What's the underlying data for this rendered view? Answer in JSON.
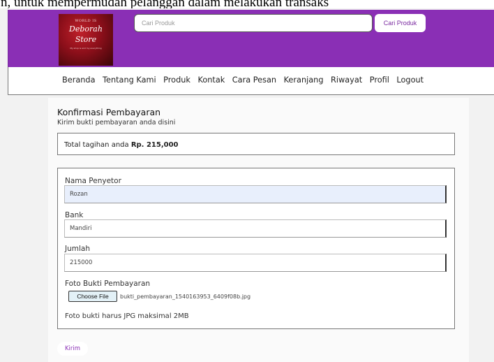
{
  "marquee": {
    "text": "n, untuk mempermudah pelanggan dalam melakukan transaks"
  },
  "logo": {
    "small": "WORLD IS",
    "script_line1": "Deborah",
    "script_line2": "Store",
    "tagline": "My shop is and my everything"
  },
  "search": {
    "placeholder": "Cari Produk",
    "button_label": "Cari Produk"
  },
  "nav": {
    "items": [
      "Beranda",
      "Tentang Kami",
      "Produk",
      "Kontak",
      "Cara Pesan",
      "Keranjang",
      "Riwayat",
      "Profil",
      "Logout"
    ]
  },
  "page": {
    "title": "Konfirmasi Pembayaran",
    "subtitle": "Kirim bukti pembayaran anda disini",
    "total_prefix": "Total tagihan anda ",
    "total_value": "Rp. 215,000"
  },
  "form": {
    "depositor_label": "Nama Penyetor",
    "depositor_value": "Rozan",
    "bank_label": "Bank",
    "bank_value": "Mandiri",
    "amount_label": "Jumlah",
    "amount_value": "215000",
    "proof_label": "Foto Bukti Pembayaran",
    "choose_file_label": "Choose File",
    "file_name": "bukti_pembayaran_1540163953_6409f08b.jpg",
    "note": "Foto bukti harus JPG maksimal 2MB",
    "submit_label": "Kirim"
  },
  "colors": {
    "brand": "#8a2fb5",
    "autofill": "#e8effc"
  }
}
